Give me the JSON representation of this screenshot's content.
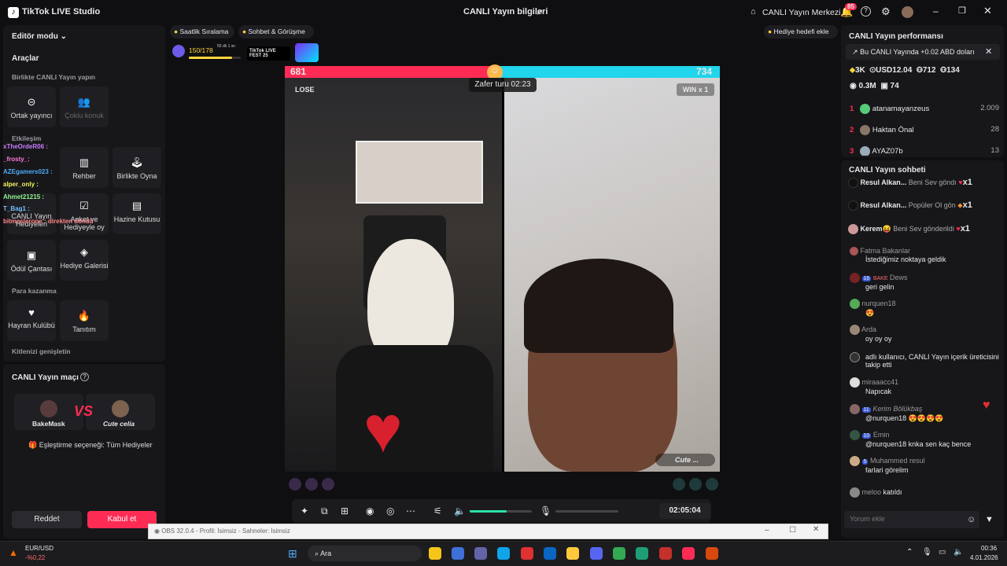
{
  "titlebar": {
    "app": "TikTok LIVE Studio",
    "center": "CANLI Yayın bilgileri",
    "center_hub": "CANLI Yayın Merkezi",
    "notif_count": "85"
  },
  "left": {
    "editor_mode": "Editör modu",
    "tools": "Araçlar",
    "section_collab": "Birlikte CANLI Yayın yapın",
    "tile_cohost": "Ortak yayıncı",
    "tile_multi": "Çoklu konuk",
    "section_interaction": "Etkileşim",
    "tile_guide": "Rehber",
    "tile_play": "Birlikte Oyna",
    "tile_live_gift": "CANLI Yayın Hediyeleri",
    "tile_poll": "Anket ve Hediyeyle oy",
    "tile_treasure": "Hazine Kutusu",
    "tile_reward": "Ödül Çantası",
    "tile_gallery": "Hediye Galerisi",
    "section_earn": "Para kazanma",
    "tile_fanclub": "Hayran Kulübü",
    "tile_promo": "Tanıtım",
    "section_grow": "Kitlenizi genişletin"
  },
  "overlay_chat": [
    {
      "user": "xTheOrdeR06 :",
      "color": "#c77dff"
    },
    {
      "user": "_frosty_:",
      "color": "#ff7ad9"
    },
    {
      "user": "AZEgamers023 :",
      "color": "#4dabf7"
    },
    {
      "user": "alper_only :",
      "color": "#f3f35a"
    },
    {
      "user": "Ahmet21215 :",
      "color": "#8ef08e"
    },
    {
      "user": "T_Bag1 :",
      "color": "#74c0fc"
    },
    {
      "user": "bitmeslerone : direkten döndü",
      "color": "#ff8787"
    }
  ],
  "match": {
    "title": "CANLI Yayın maçı",
    "left_name": "BakeMask",
    "right_name": "Cute celia",
    "matching": "Eşleştirme seçeneği: Tüm Hediyeler",
    "decline": "Reddet",
    "accept": "Kabul et"
  },
  "top_tabs": {
    "hourly": "Saatlik Sıralama",
    "chat": "Sohbet & Görüşme",
    "gift_goal": "Hediye hedefi ekle",
    "progress": "150/178",
    "progress_frac": 0.84,
    "progress_sub": "55 dk 1 sn",
    "fest": "TikTok LIVE FEST 25"
  },
  "battle": {
    "left_score": "681",
    "right_score": "734",
    "timer": "Zafer turu 02:23",
    "left_result": "LOSE",
    "right_result": "WIN x 1",
    "right_tag": "Cute ...",
    "left_share": 0.48
  },
  "controls": {
    "time": "02:05:04",
    "volume": 0.6
  },
  "perf": {
    "title": "CANLI Yayın performansı",
    "banner": "Bu CANLI Yayında +0.02 ABD doları",
    "likes": "3K",
    "usd": "USD12.04",
    "followers": "712",
    "gifters": "134",
    "views": "0.3M",
    "comments": "74"
  },
  "ranking": [
    {
      "rank": "1",
      "name": "atanamayanzeus",
      "score": "2.009"
    },
    {
      "rank": "2",
      "name": "Haktan Önal",
      "score": "28"
    },
    {
      "rank": "3",
      "name": "AYAZ07b",
      "score": "13"
    }
  ],
  "chat": {
    "title": "CANLI Yayın sohbeti",
    "gifts": [
      {
        "user": "Resul Alkan...",
        "text": "Beni Sev göndı",
        "count": "x1"
      },
      {
        "user": "Resul Alkan...",
        "text": "Popüler Ol gön",
        "count": "x1"
      },
      {
        "user": "Kerem😝",
        "text": "Beni Sev gönderildi",
        "count": "x1"
      }
    ],
    "messages": [
      {
        "name": "Fatma Bakanlar",
        "text": "İstediğimiz noktaya geldik"
      },
      {
        "name": "Dews",
        "badge": "16",
        "badge2": "BAKE",
        "text": "geri gelin"
      },
      {
        "name": "nurquen18",
        "text": "😍"
      },
      {
        "name": "Arda",
        "text": "oy oy oy"
      },
      {
        "name": "",
        "text": "adlı kullanıcı, CANLI Yayın içerik üreticisini takip etti"
      },
      {
        "name": "miraaacc41",
        "text": "Napıcak"
      },
      {
        "name": "Kerim Bölükbaş",
        "badge": "11",
        "text": "@nurquen18 😍😍😍😍"
      },
      {
        "name": "Emin",
        "badge": "10",
        "text": "@nurquen18 knka sen kaç bence"
      },
      {
        "name": "Muhammed resul",
        "badge": "5",
        "text": "farlari görelim"
      },
      {
        "name": "meloo",
        "text": "katıldı"
      }
    ],
    "placeholder": "Yorum ekle"
  },
  "obs": {
    "title": "OBS 32.0.4 - Profil: İsimsiz - Sahneler: İsimsiz"
  },
  "taskbar": {
    "search": "Ara",
    "currency": "EUR/USD",
    "change": "-%0,22",
    "time": "00:36",
    "date": "4.01.2026"
  }
}
